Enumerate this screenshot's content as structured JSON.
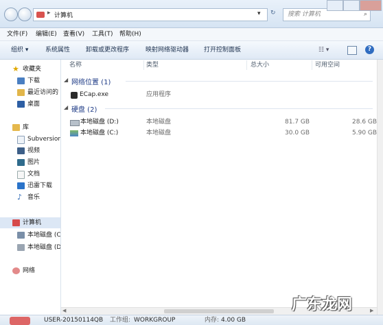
{
  "address": {
    "crumb": "计算机"
  },
  "search": {
    "placeholder": "搜索 计算机"
  },
  "menubar": [
    "文件(F)",
    "编辑(E)",
    "查看(V)",
    "工具(T)",
    "帮助(H)"
  ],
  "toolbar": {
    "organize": "组织",
    "system_properties": "系统属性",
    "uninstall": "卸载或更改程序",
    "map_drive": "映射网络驱动器",
    "control_panel": "打开控制面板"
  },
  "nav": {
    "favorites": "收藏夹",
    "downloads": "下载",
    "recent": "最近访问的",
    "desktop": "桌面",
    "libraries": "库",
    "subversion": "Subversion",
    "videos": "视频",
    "pictures": "图片",
    "documents": "文档",
    "thunder": "迅雷下载",
    "music": "音乐",
    "computer": "计算机",
    "disk_c": "本地磁盘 (C",
    "disk_d": "本地磁盘 (D",
    "network": "网络"
  },
  "columns": {
    "name": "名称",
    "type": "类型",
    "total": "总大小",
    "free": "可用空间"
  },
  "groups": {
    "network_locations": "网络位置 (1)",
    "hard_disks": "硬盘 (2)"
  },
  "network_items": [
    {
      "name": "ECap.exe",
      "type": "应用程序"
    }
  ],
  "disks": [
    {
      "name": "本地磁盘 (D:)",
      "type": "本地磁盘",
      "total": "81.7 GB",
      "free": "28.6 GB"
    },
    {
      "name": "本地磁盘 (C:)",
      "type": "本地磁盘",
      "total": "30.0 GB",
      "free": "5.90 GB"
    }
  ],
  "details": {
    "computer_name": "USER-20150114QB",
    "workgroup_label": "工作组:",
    "workgroup": "WORKGROUP",
    "memory_label": "内存:",
    "memory": "4.00 GB"
  },
  "watermark": "广东龙网",
  "colors": {
    "group_text": "#1e3b86",
    "accent": "#3a6fb0"
  }
}
